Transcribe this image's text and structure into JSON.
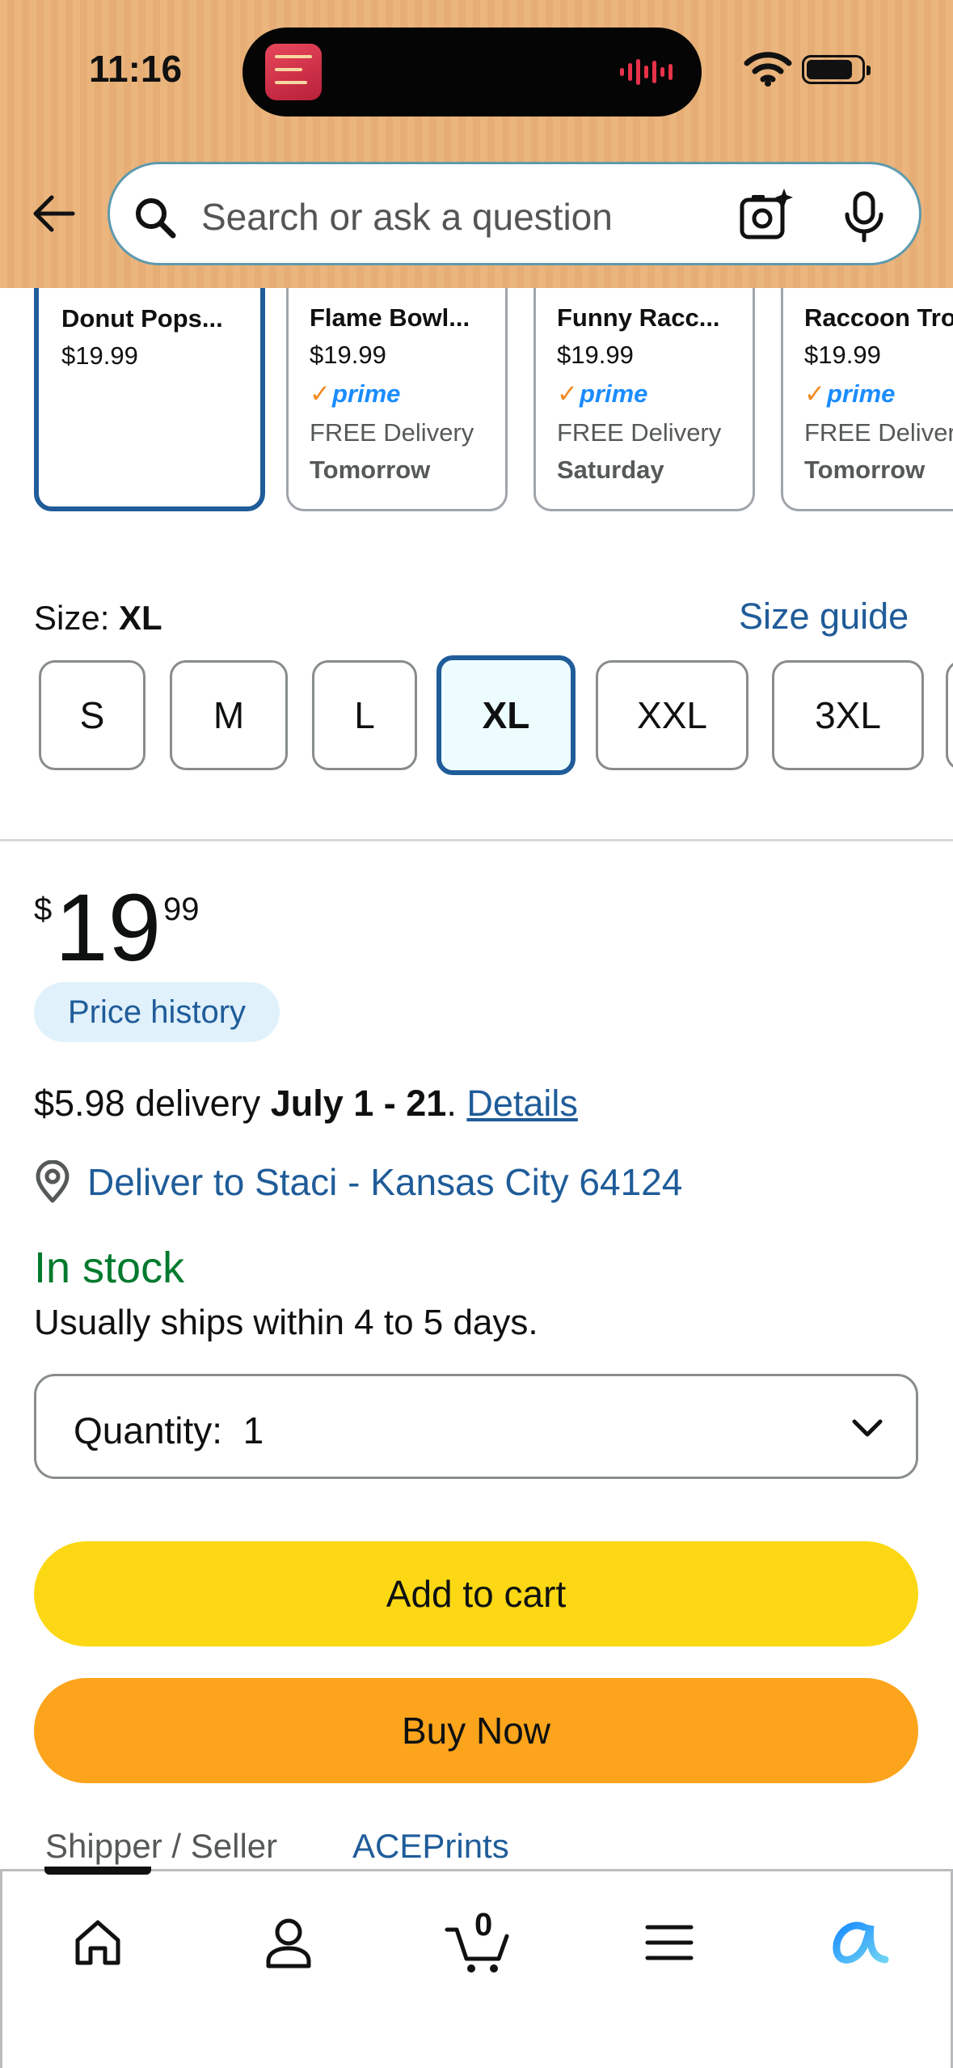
{
  "status_bar": {
    "time": "11:16"
  },
  "search": {
    "placeholder": "Search or ask a question"
  },
  "variants": [
    {
      "title": "Donut Pops...",
      "price": "$19.99",
      "selected": true
    },
    {
      "title": "Flame Bowl...",
      "price": "$19.99",
      "prime": "prime",
      "delivery": "FREE Delivery",
      "day": "Tomorrow"
    },
    {
      "title": "Funny Racc...",
      "price": "$19.99",
      "prime": "prime",
      "delivery": "FREE Delivery",
      "day": "Saturday"
    },
    {
      "title": "Raccoon Tro",
      "price": "$19.99",
      "prime": "prime",
      "delivery": "FREE Deliver",
      "day": "Tomorrow"
    }
  ],
  "size": {
    "label": "Size: ",
    "value": "XL",
    "guide": "Size guide",
    "options": [
      "S",
      "M",
      "L",
      "XL",
      "XXL",
      "3XL"
    ]
  },
  "price": {
    "symbol": "$",
    "whole": "19",
    "fraction": "99",
    "history_label": "Price history"
  },
  "delivery": {
    "cost": "$5.98 delivery ",
    "dates": "July 1 - 21",
    "period": ". ",
    "details_link": "Details",
    "deliver_to": "Deliver to Staci - Kansas City 64124"
  },
  "stock": {
    "status": "In stock",
    "ships": "Usually ships within 4 to 5 days."
  },
  "quantity": {
    "label": "Quantity:  1"
  },
  "buttons": {
    "add_to_cart": "Add to cart",
    "buy_now": "Buy Now"
  },
  "seller": {
    "label": "Shipper / Seller",
    "value": "ACEPrints"
  },
  "bottom_nav": {
    "cart_count": "0",
    "items": [
      "home-icon",
      "account-icon",
      "cart-icon",
      "menu-icon",
      "rufus-icon"
    ]
  },
  "colors": {
    "header": "#EBB57E",
    "link": "#1F5C99",
    "add_to_cart": "#FCD814",
    "buy_now": "#FCA41C",
    "in_stock": "#007A2E",
    "prime": "#1A8CFF"
  }
}
